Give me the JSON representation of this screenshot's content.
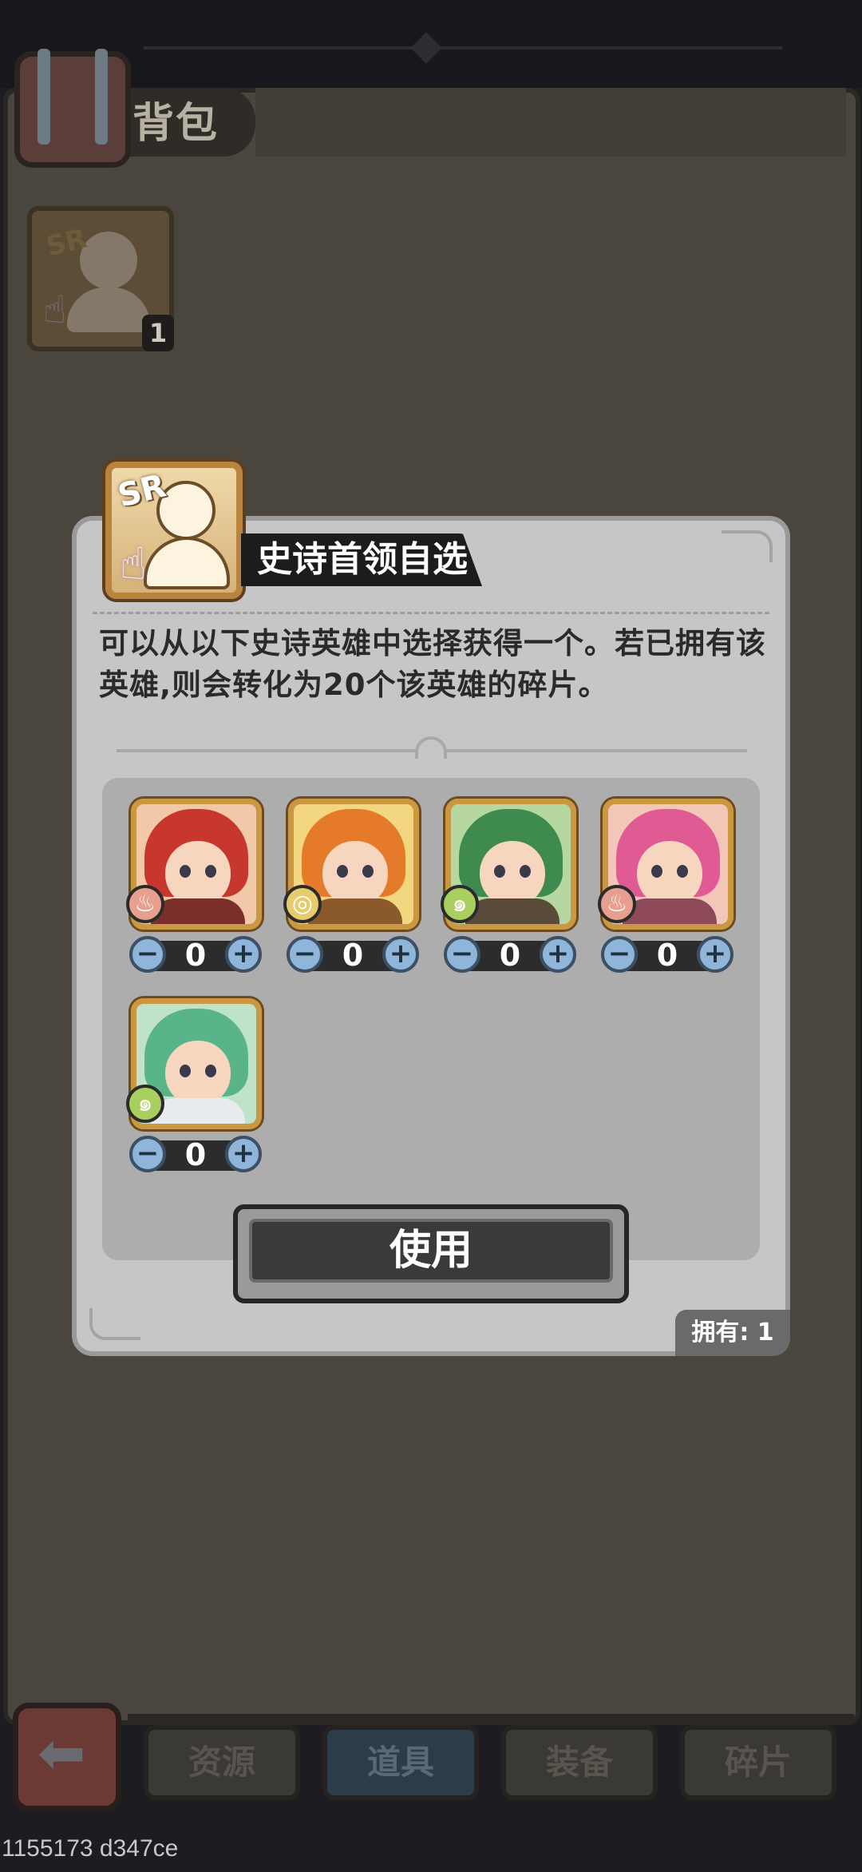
{
  "bag": {
    "title": "背包",
    "items": [
      {
        "icon": "epic-leader-selector-icon",
        "badge": "SR",
        "count": "1"
      }
    ]
  },
  "dialog": {
    "badge": "SR",
    "title": "史诗首领自选",
    "description_line1": "可以从以下史诗英雄中选择获得一个。若已拥有该",
    "description_line2": "英雄,则会转化为20个该英雄的碎片。",
    "heroes": [
      {
        "element": "fire",
        "element_color": "#e7a08e",
        "quantity": "0",
        "hair": "#c8372e",
        "bg": "#f2c9a8",
        "body": "#7a2f2a"
      },
      {
        "element": "earth",
        "element_color": "#e6cc6d",
        "quantity": "0",
        "hair": "#e47a2a",
        "bg": "#f3d780",
        "body": "#8a5a2a"
      },
      {
        "element": "wind",
        "element_color": "#a9cf5e",
        "quantity": "0",
        "hair": "#3f8a4e",
        "bg": "#b6d7a0",
        "body": "#5a4a3a"
      },
      {
        "element": "fire",
        "element_color": "#e7a08e",
        "quantity": "0",
        "hair": "#e05a93",
        "bg": "#f3c7b8",
        "body": "#8f4a5a"
      },
      {
        "element": "wind",
        "element_color": "#a9cf5e",
        "quantity": "0",
        "hair": "#59b48a",
        "bg": "#bfe3c8",
        "body": "#e8ecef"
      }
    ],
    "minus_symbol": "−",
    "plus_symbol": "+",
    "use_button": "使用",
    "owned_label": "拥有: 1"
  },
  "tabs": [
    {
      "label": "资源",
      "active": false
    },
    {
      "label": "道具",
      "active": true
    },
    {
      "label": "装备",
      "active": false
    },
    {
      "label": "碎片",
      "active": false
    }
  ],
  "back_icon": "arrow-left-icon",
  "footer": {
    "id_text": "1155173 d347ce"
  },
  "colors": {
    "accent_gold": "#c99841",
    "stepper_blue": "#8fb6da",
    "dialog_bg": "#c6c6c6"
  }
}
